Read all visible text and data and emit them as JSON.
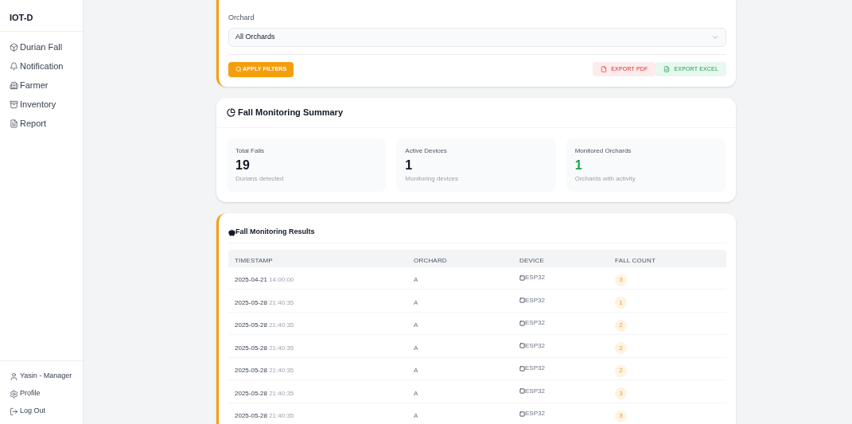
{
  "sidebar": {
    "brand": "IOT-D",
    "items": [
      {
        "label": "Durian Fall"
      },
      {
        "label": "Notification"
      },
      {
        "label": "Farmer"
      },
      {
        "label": "Inventory"
      },
      {
        "label": "Report"
      }
    ],
    "footer": [
      {
        "label": "Yasin - Manager"
      },
      {
        "label": "Profile"
      },
      {
        "label": "Log Out"
      }
    ]
  },
  "filters": {
    "orchard_label": "Orchard",
    "orchard_value": "All Orchards",
    "apply": "APPLY FILTERS",
    "export_pdf": "EXPORT PDF",
    "export_excel": "EXPORT EXCEL"
  },
  "summary": {
    "title": "Fall Monitoring Summary",
    "stats": [
      {
        "label": "Total Falls",
        "value": "19",
        "caption": "Durians detected",
        "color": "#111827"
      },
      {
        "label": "Active Devices",
        "value": "1",
        "caption": "Monitoring devices",
        "color": "#111827"
      },
      {
        "label": "Monitored Orchards",
        "value": "1",
        "caption": "Orchards with activity",
        "color": "#16a34a"
      }
    ]
  },
  "results": {
    "title": "Fall Monitoring Results",
    "columns": [
      "TIMESTAMP",
      "ORCHARD",
      "DEVICE",
      "FALL COUNT"
    ],
    "rows": [
      {
        "date": "2025-04-21",
        "time": "14:00:00",
        "orchard": "A",
        "device": "ESP32",
        "count": "3"
      },
      {
        "date": "2025-05-28",
        "time": "21:40:35",
        "orchard": "A",
        "device": "ESP32",
        "count": "1"
      },
      {
        "date": "2025-05-28",
        "time": "21:40:35",
        "orchard": "A",
        "device": "ESP32",
        "count": "2"
      },
      {
        "date": "2025-05-28",
        "time": "21:40:35",
        "orchard": "A",
        "device": "ESP32",
        "count": "2"
      },
      {
        "date": "2025-05-28",
        "time": "21:40:35",
        "orchard": "A",
        "device": "ESP32",
        "count": "2"
      },
      {
        "date": "2025-05-28",
        "time": "21:40:35",
        "orchard": "A",
        "device": "ESP32",
        "count": "3"
      },
      {
        "date": "2025-05-28",
        "time": "21:40:35",
        "orchard": "A",
        "device": "ESP32",
        "count": "3"
      }
    ]
  }
}
